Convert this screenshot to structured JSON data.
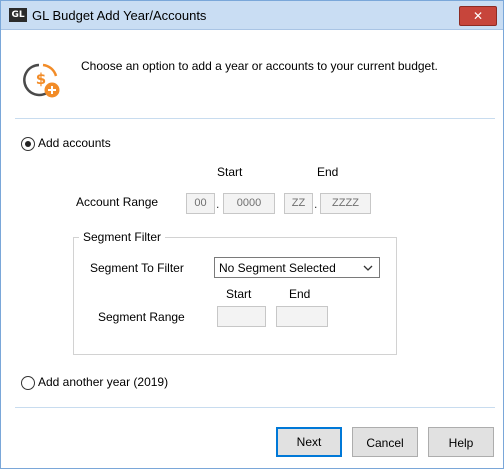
{
  "window": {
    "app_icon_text": "GL",
    "title": "GL Budget Add Year/Accounts",
    "close_glyph": "✕"
  },
  "header": {
    "icon": "budget-add-icon",
    "message": "Choose an option to add a year or accounts to your current budget."
  },
  "add_accounts": {
    "label": "Add accounts",
    "selected": true,
    "start_label": "Start",
    "end_label": "End",
    "account_range_label": "Account Range",
    "start_segment1": "00",
    "start_segment2": "0000",
    "end_segment1": "ZZ",
    "end_segment2": "ZZZZ",
    "separator": "."
  },
  "segment_filter": {
    "title": "Segment Filter",
    "filter_label": "Segment To Filter",
    "selected_option": "No Segment Selected",
    "start_label": "Start",
    "end_label": "End",
    "range_label": "Segment Range",
    "range_start": "",
    "range_end": ""
  },
  "add_year": {
    "label": "Add another year (2019)",
    "selected": false
  },
  "buttons": {
    "next": "Next",
    "cancel": "Cancel",
    "help": "Help"
  },
  "colors": {
    "titlebar": "#c9ddf3",
    "close_button": "#c7453b",
    "focus_border": "#0078d7",
    "icon_orange": "#f28c28"
  }
}
